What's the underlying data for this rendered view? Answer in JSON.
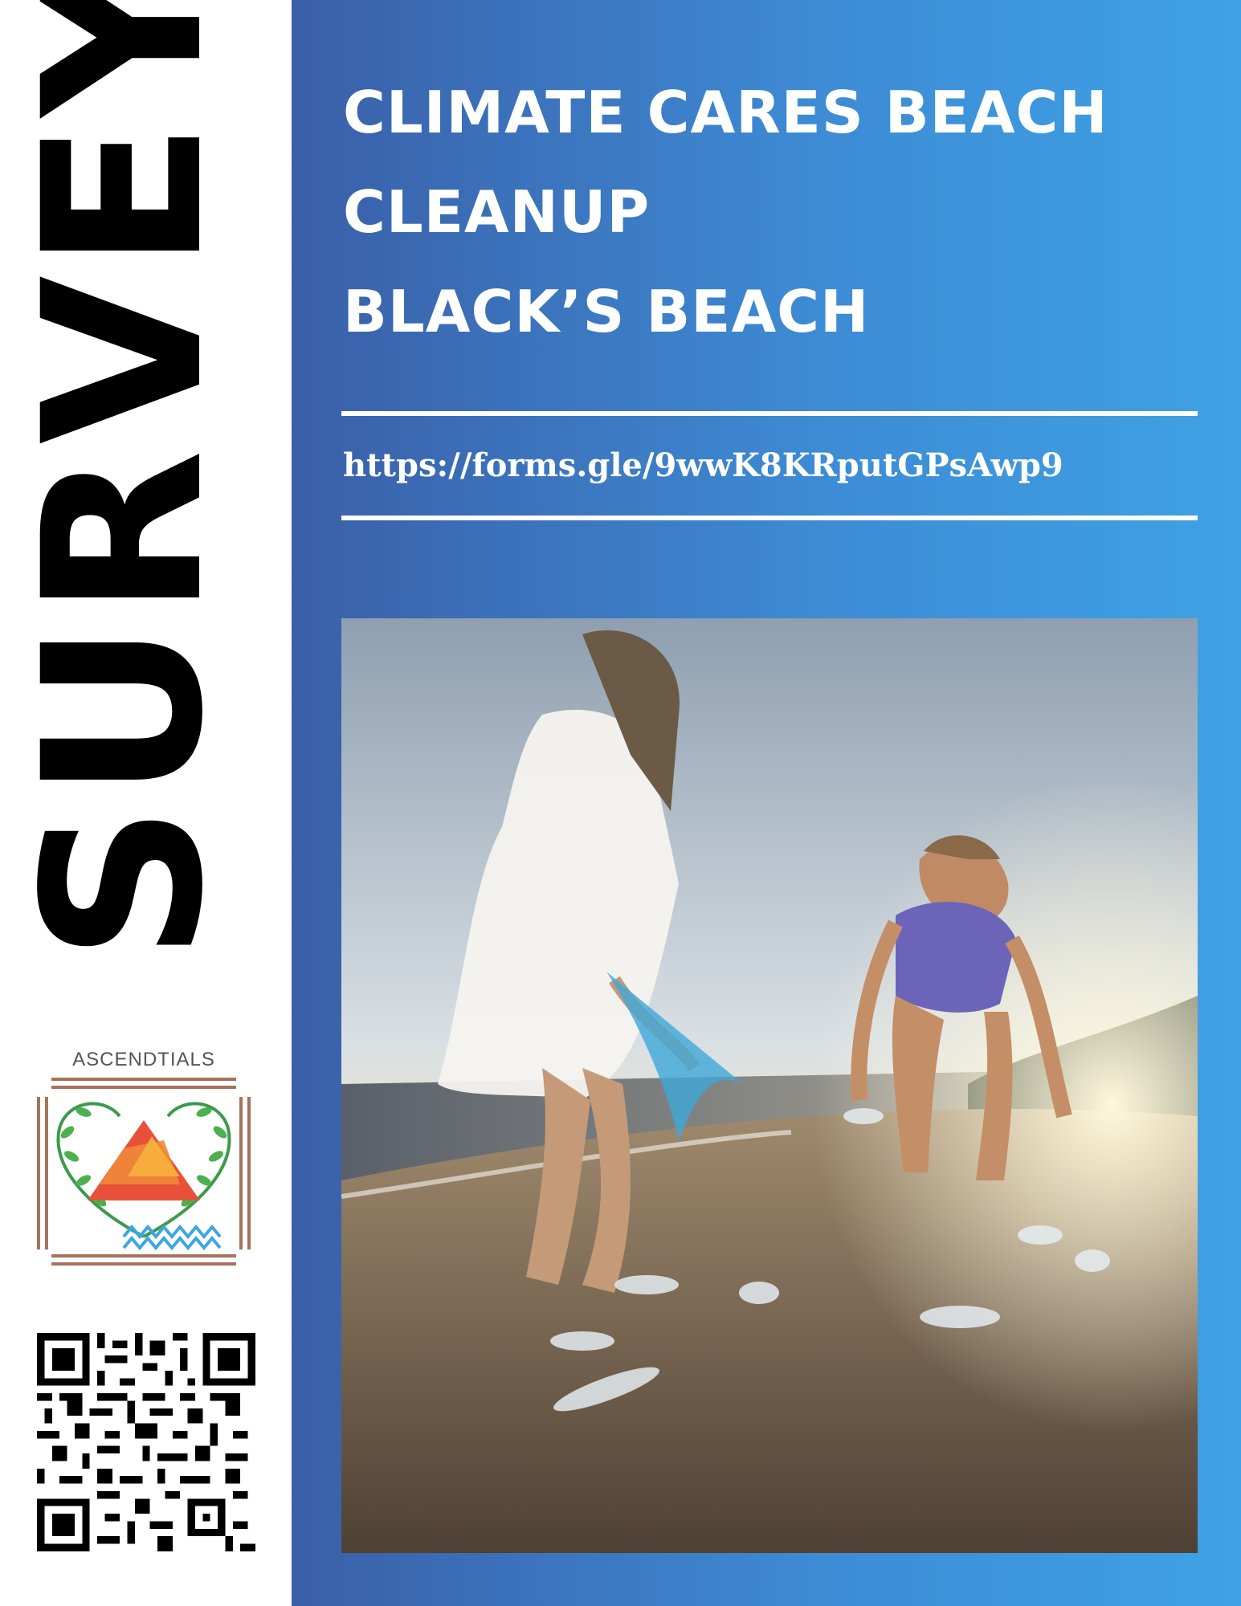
{
  "sidebar": {
    "vertical_title": "SURVEY",
    "logo": {
      "name": "ASCENDTIALS",
      "icon": "ascendtials-logo"
    },
    "qr_code": {
      "icon": "qr-code-icon"
    }
  },
  "main": {
    "title_lines": [
      "CLIMATE CARES BEACH",
      "CLEANUP",
      "BLACK’S BEACH"
    ],
    "url": "https://forms.gle/9wwK8KRputGPsAwp9",
    "photo": {
      "icon": "beach-cleanup-photo"
    }
  },
  "colors": {
    "gradient_start": "#3a5fa8",
    "gradient_end": "#3ea2e4",
    "text_on_blue": "#ffffff",
    "sidebar_bg": "#ffffff"
  }
}
